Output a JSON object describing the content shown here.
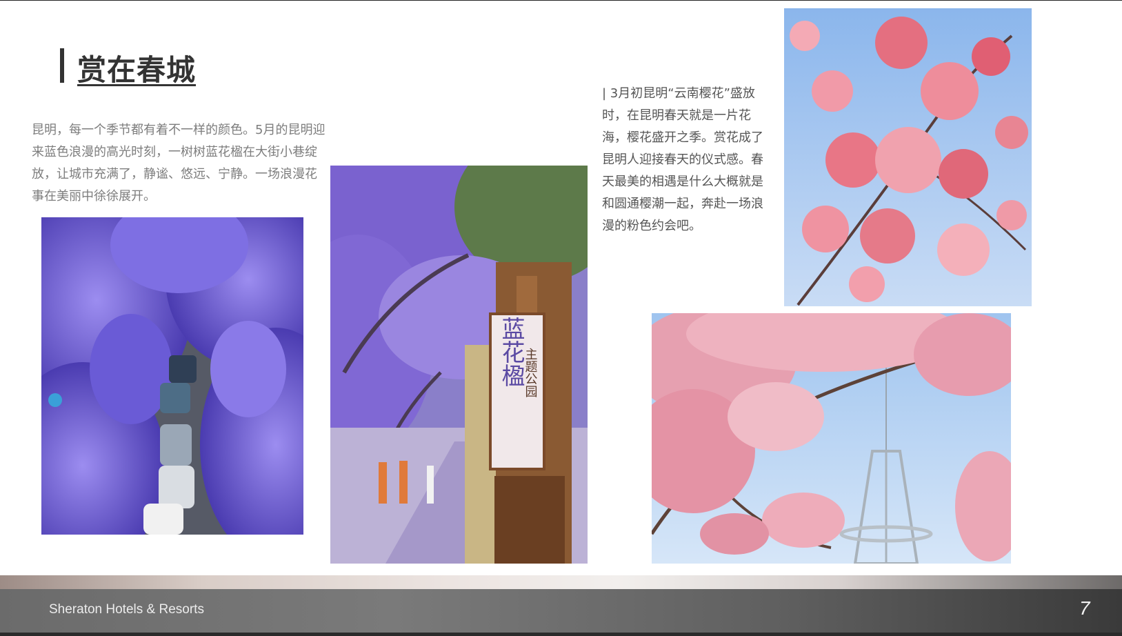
{
  "slide": {
    "title": "赏在春城",
    "intro": "昆明，每一个季节都有着不一样的颜色。5月的昆明迎来蓝色浪漫的高光时刻，一树树蓝花楹在大街小巷绽放，让城市充满了，静谧、悠远、宁静。一场浪漫花事在美丽中徐徐展开。",
    "side_text": "| 3月初昆明“云南樱花”盛放时，在昆明春天就是一片花海，樱花盛开之季。赏花成了昆明人迎接春天的仪式感。春天最美的相遇是什么大概就是和圆通樱潮一起，奔赴一场浪漫的粉色约会吧。",
    "sign_text": "蓝花楹",
    "sign_sub": "主题公园"
  },
  "footer": {
    "brand": "Sheraton Hotels & Resorts",
    "page_number": "7"
  },
  "colors": {
    "jacaranda": "#6f5fd1",
    "sakura": "#e9899a",
    "sky": "#a9cdf0"
  }
}
